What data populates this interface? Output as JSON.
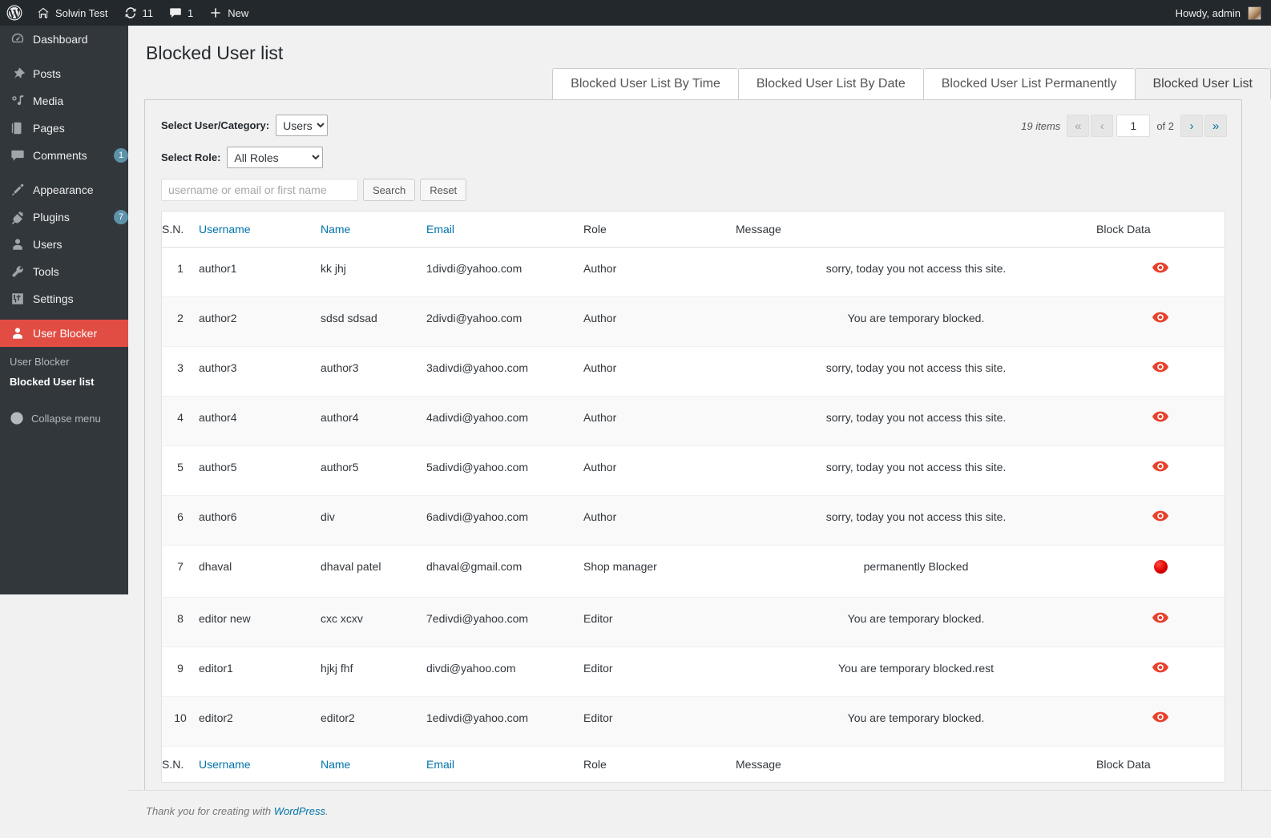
{
  "adminbar": {
    "logo_icon": "wordpress-logo-icon",
    "site_name": "Solwin Test",
    "site_icon": "home-icon",
    "updates_icon": "updates-icon",
    "updates_count": "11",
    "comments_icon": "comment-bubble-icon",
    "comments_count": "1",
    "new_icon": "plus-icon",
    "new_label": "New",
    "howdy": "Howdy, admin",
    "avatar": "user-avatar"
  },
  "sidebar": {
    "items": [
      {
        "label": "Dashboard",
        "icon": "dashboard-icon",
        "badge": ""
      },
      {
        "label": "Posts",
        "icon": "pin-icon",
        "badge": ""
      },
      {
        "label": "Media",
        "icon": "media-icon",
        "badge": ""
      },
      {
        "label": "Pages",
        "icon": "pages-icon",
        "badge": ""
      },
      {
        "label": "Comments",
        "icon": "comment-bubble-icon",
        "badge": "1"
      },
      {
        "label": "Appearance",
        "icon": "brush-icon",
        "badge": ""
      },
      {
        "label": "Plugins",
        "icon": "plug-icon",
        "badge": "7"
      },
      {
        "label": "Users",
        "icon": "user-icon",
        "badge": ""
      },
      {
        "label": "Tools",
        "icon": "wrench-icon",
        "badge": ""
      },
      {
        "label": "Settings",
        "icon": "sliders-icon",
        "badge": ""
      },
      {
        "label": "User Blocker",
        "icon": "user-icon",
        "badge": ""
      }
    ],
    "submenu": [
      {
        "label": "User Blocker",
        "current": false
      },
      {
        "label": "Blocked User list",
        "current": true
      }
    ],
    "collapse": {
      "label": "Collapse menu",
      "icon": "chevron-left-circle-icon"
    },
    "accent_color": "#e14d43",
    "background_color": "#32373c"
  },
  "page": {
    "title": "Blocked User list"
  },
  "tabs": [
    {
      "label": "Blocked User List By Time",
      "active": false
    },
    {
      "label": "Blocked User List By Date",
      "active": false
    },
    {
      "label": "Blocked User List Permanently",
      "active": false
    },
    {
      "label": "Blocked User List",
      "active": true
    }
  ],
  "filters": {
    "user_category_label": "Select User/Category:",
    "user_category_value": "Users",
    "user_category_options": [
      "Users"
    ],
    "role_label": "Select Role:",
    "role_value": "All Roles",
    "role_options": [
      "All Roles"
    ],
    "search_placeholder": "username or email or first name",
    "search_value": "",
    "search_button": "Search",
    "reset_button": "Reset"
  },
  "pagination": {
    "items_text": "19 items",
    "first_icon": "«",
    "prev_icon": "‹",
    "current_page": "1",
    "of_text": "of 2",
    "next_icon": "›",
    "last_icon": "»"
  },
  "table": {
    "columns": [
      {
        "key": "sn",
        "label": "S.N.",
        "link": false
      },
      {
        "key": "user",
        "label": "Username",
        "link": true
      },
      {
        "key": "name",
        "label": "Name",
        "link": true
      },
      {
        "key": "email",
        "label": "Email",
        "link": true
      },
      {
        "key": "role",
        "label": "Role",
        "link": false
      },
      {
        "key": "msg",
        "label": "Message",
        "link": false
      },
      {
        "key": "blk",
        "label": "Block Data",
        "link": false
      }
    ],
    "rows": [
      {
        "sn": "1",
        "user": "author1",
        "name": "kk jhj",
        "email": "1divdi@yahoo.com",
        "role": "Author",
        "msg": "sorry, today you not access this site.",
        "icon": "eye-icon"
      },
      {
        "sn": "2",
        "user": "author2",
        "name": "sdsd sdsad",
        "email": "2divdi@yahoo.com",
        "role": "Author",
        "msg": "You are temporary blocked.",
        "icon": "eye-icon"
      },
      {
        "sn": "3",
        "user": "author3",
        "name": "author3",
        "email": "3adivdi@yahoo.com",
        "role": "Author",
        "msg": "sorry, today you not access this site.",
        "icon": "eye-icon"
      },
      {
        "sn": "4",
        "user": "author4",
        "name": "author4",
        "email": "4adivdi@yahoo.com",
        "role": "Author",
        "msg": "sorry, today you not access this site.",
        "icon": "eye-icon"
      },
      {
        "sn": "5",
        "user": "author5",
        "name": "author5",
        "email": "5adivdi@yahoo.com",
        "role": "Author",
        "msg": "sorry, today you not access this site.",
        "icon": "eye-icon"
      },
      {
        "sn": "6",
        "user": "author6",
        "name": "div",
        "email": "6adivdi@yahoo.com",
        "role": "Author",
        "msg": "sorry, today you not access this site.",
        "icon": "eye-icon"
      },
      {
        "sn": "7",
        "user": "dhaval",
        "name": "dhaval patel",
        "email": "dhaval@gmail.com",
        "role": "Shop manager",
        "msg": "permanently Blocked",
        "icon": "red-dot-icon"
      },
      {
        "sn": "8",
        "user": "editor new",
        "name": "cxc xcxv",
        "email": "7edivdi@yahoo.com",
        "role": "Editor",
        "msg": "You are temporary blocked.",
        "icon": "eye-icon"
      },
      {
        "sn": "9",
        "user": "editor1",
        "name": "hjkj fhf",
        "email": "divdi@yahoo.com",
        "role": "Editor",
        "msg": "You are temporary blocked.rest",
        "icon": "eye-icon"
      },
      {
        "sn": "10",
        "user": "editor2",
        "name": "editor2",
        "email": "1edivdi@yahoo.com",
        "role": "Editor",
        "msg": "You are temporary blocked.",
        "icon": "eye-icon"
      }
    ],
    "link_color": "#0073aa",
    "eye_icon_color": "#e8412c"
  },
  "footer": {
    "thanks_prefix": "Thank you for creating with ",
    "link_label": "WordPress",
    "suffix": "."
  }
}
